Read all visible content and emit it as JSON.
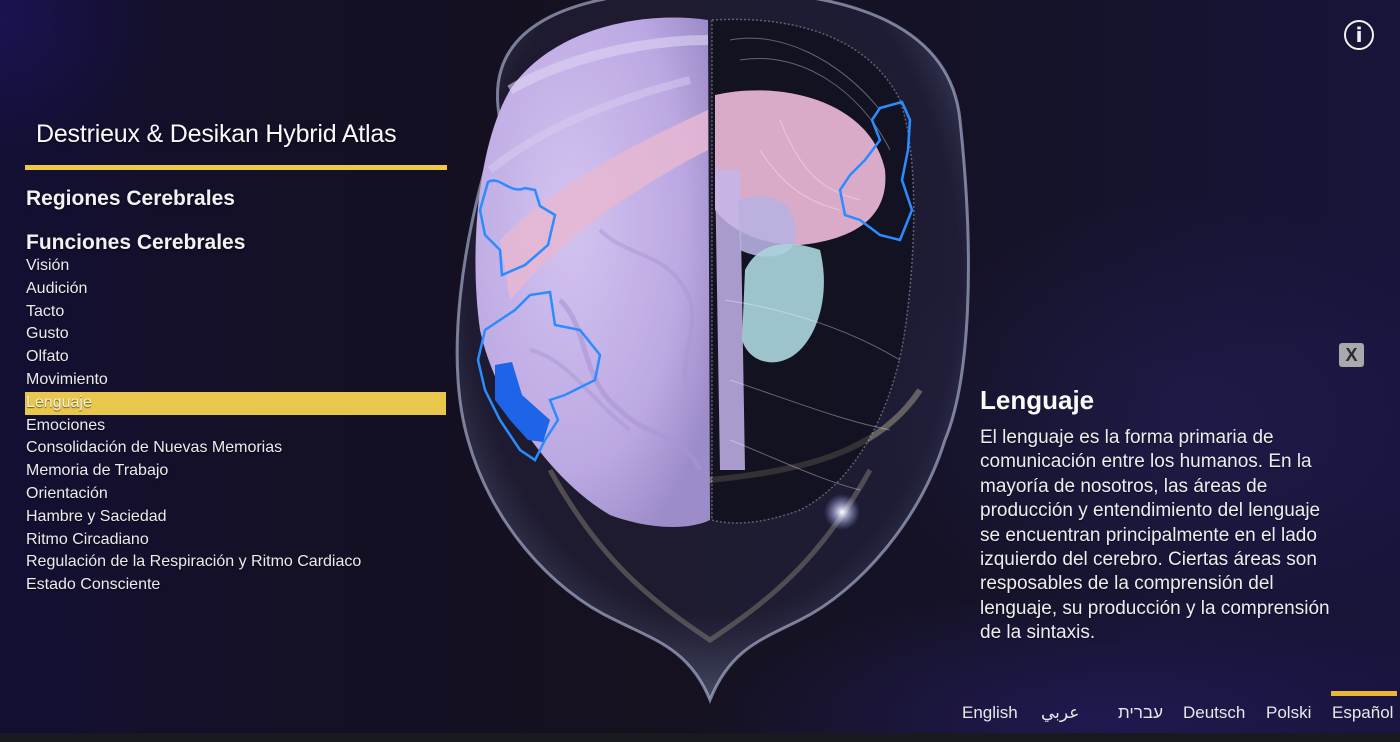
{
  "app": {
    "atlas_title": "Destrieux & Desikan Hybrid Atlas",
    "accent_color": "#ecc948"
  },
  "sidebar": {
    "sections": [
      {
        "label": "Regiones Cerebrales"
      },
      {
        "label": "Funciones Cerebrales"
      }
    ],
    "functions": [
      {
        "label": "Visión",
        "active": false
      },
      {
        "label": "Audición",
        "active": false
      },
      {
        "label": "Tacto",
        "active": false
      },
      {
        "label": "Gusto",
        "active": false
      },
      {
        "label": "Olfato",
        "active": false
      },
      {
        "label": "Movimiento",
        "active": false
      },
      {
        "label": "Lenguaje",
        "active": true
      },
      {
        "label": "Emociones",
        "active": false
      },
      {
        "label": "Consolidación de Nuevas Memorias",
        "active": false
      },
      {
        "label": "Memoria de Trabajo",
        "active": false
      },
      {
        "label": "Orientación",
        "active": false
      },
      {
        "label": "Hambre y Saciedad",
        "active": false
      },
      {
        "label": "Ritmo Circadiano",
        "active": false
      },
      {
        "label": "Regulación de la Respiración y Ritmo Cardiaco",
        "active": false
      },
      {
        "label": "Estado Consciente",
        "active": false
      }
    ]
  },
  "toolbar": {
    "info_icon": "i",
    "close_label": "X"
  },
  "description": {
    "title": "Lenguaje",
    "body": "El lenguaje es la forma primaria de comunicación entre los humanos. En la mayoría de nosotros, las áreas de producción y entendimiento del lenguaje se encuentran principalmente en el lado izquierdo del cerebro. Ciertas áreas son resposables de la comprensión del lenguaje, su producción y la comprensión de la sintaxis."
  },
  "languages": [
    {
      "label": "English",
      "active": false
    },
    {
      "label": "عربي",
      "active": false
    },
    {
      "label": "עברית",
      "active": false
    },
    {
      "label": "Deutsch",
      "active": false
    },
    {
      "label": "Polski",
      "active": false
    },
    {
      "label": "Español",
      "active": true
    }
  ],
  "scene": {
    "highlight_color": "#2a7fff",
    "cortex_color": "#c9b8ec",
    "region_pink": "#e9b6d4",
    "region_cyan": "#a9d4dc"
  }
}
